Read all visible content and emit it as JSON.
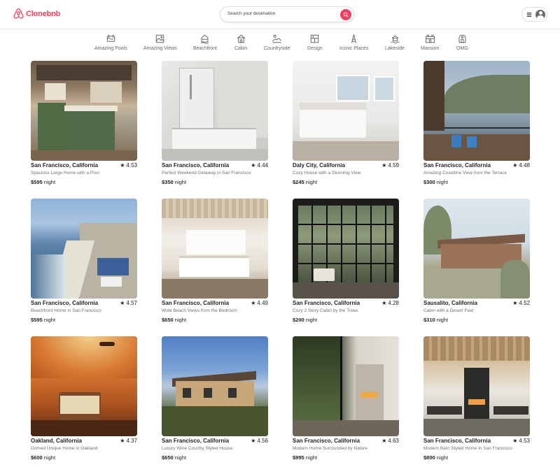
{
  "brand": {
    "name": "Clonebnb",
    "accent": "#f43f5e"
  },
  "search": {
    "placeholder": "Search your destination"
  },
  "icons": {
    "search": "search-icon",
    "menu": "hamburger-menu-icon",
    "avatar": "user-avatar-icon",
    "rating": "star-icon"
  },
  "categories": [
    {
      "label": "Amazing Pools",
      "icon": "pool-icon"
    },
    {
      "label": "Amazing Views",
      "icon": "views-icon"
    },
    {
      "label": "Beachfront",
      "icon": "beachfront-icon"
    },
    {
      "label": "Cabin",
      "icon": "cabin-icon"
    },
    {
      "label": "Countryside",
      "icon": "countryside-icon"
    },
    {
      "label": "Design",
      "icon": "design-icon"
    },
    {
      "label": "Iconic Places",
      "icon": "iconic-places-icon"
    },
    {
      "label": "Lakeside",
      "icon": "lakeside-icon"
    },
    {
      "label": "Mansion",
      "icon": "mansion-icon"
    },
    {
      "label": "OMG",
      "icon": "omg-icon"
    }
  ],
  "listings": [
    {
      "location": "San Francisco, California",
      "rating": "4.53",
      "title": "Spacious Large Home with a Pool",
      "price": "$595",
      "unit": "night"
    },
    {
      "location": "San Francisco, California",
      "rating": "4.44",
      "title": "Perfect Weekend Getaway in San Francisco",
      "price": "$350",
      "unit": "night"
    },
    {
      "location": "Daly City, California",
      "rating": "4.59",
      "title": "Cozy House with a Stunning View",
      "price": "$245",
      "unit": "night"
    },
    {
      "location": "San Francisco, California",
      "rating": "4.48",
      "title": "Amazing Coastline View from the Terrace",
      "price": "$300",
      "unit": "night"
    },
    {
      "location": "San Francisco, California",
      "rating": "4.57",
      "title": "Beachfront Home in San Francisco",
      "price": "$595",
      "unit": "night"
    },
    {
      "location": "San Francisco, California",
      "rating": "4.49",
      "title": "Wide Beach Views from the Bedroom",
      "price": "$650",
      "unit": "night"
    },
    {
      "location": "San Francisco, California",
      "rating": "4.28",
      "title": "Cozy 2 Story Cabin by the Trees",
      "price": "$200",
      "unit": "night"
    },
    {
      "location": "Sausalito, California",
      "rating": "4.52",
      "title": "Cabin with a Desert Feel",
      "price": "$310",
      "unit": "night"
    },
    {
      "location": "Oakland, California",
      "rating": "4.37",
      "title": "Domed Unique Home in Oakland",
      "price": "$600",
      "unit": "night"
    },
    {
      "location": "San Francisco, California",
      "rating": "4.56",
      "title": "Luxury Wine Country Styled House",
      "price": "$650",
      "unit": "night"
    },
    {
      "location": "San Francisco, California",
      "rating": "4.63",
      "title": "Modern Home Surrounded by Nature",
      "price": "$995",
      "unit": "night"
    },
    {
      "location": "San Francisco, California",
      "rating": "4.53",
      "title": "Modern Barn Styled Home in San Francisco",
      "price": "$800",
      "unit": "night"
    }
  ]
}
